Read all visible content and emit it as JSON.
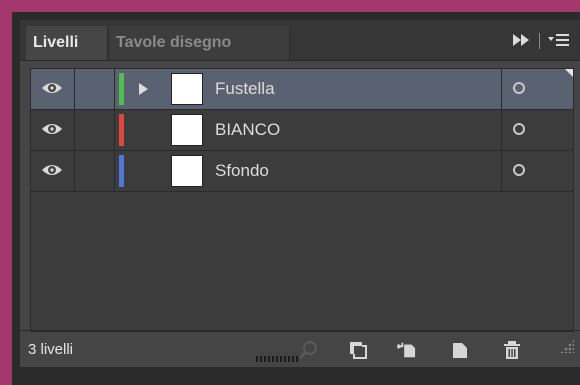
{
  "tabs": [
    {
      "label": "Livelli",
      "active": true
    },
    {
      "label": "Tavole disegno",
      "active": false
    }
  ],
  "panel_menu_icons": [
    "expand-panel-icon",
    "panel-menu-icon"
  ],
  "layers": [
    {
      "name": "Fustella",
      "color": "#4fbf4f",
      "selected": true,
      "has_children": true
    },
    {
      "name": "BIANCO",
      "color": "#e0463f",
      "selected": false,
      "has_children": false
    },
    {
      "name": "Sfondo",
      "color": "#4f78d6",
      "selected": false,
      "has_children": false
    }
  ],
  "footer": {
    "count_label": "3 livelli",
    "buttons": [
      "locate-object-icon",
      "make-clipping-mask-icon",
      "create-sublayer-icon",
      "create-new-layer-icon",
      "delete-layer-icon"
    ]
  }
}
